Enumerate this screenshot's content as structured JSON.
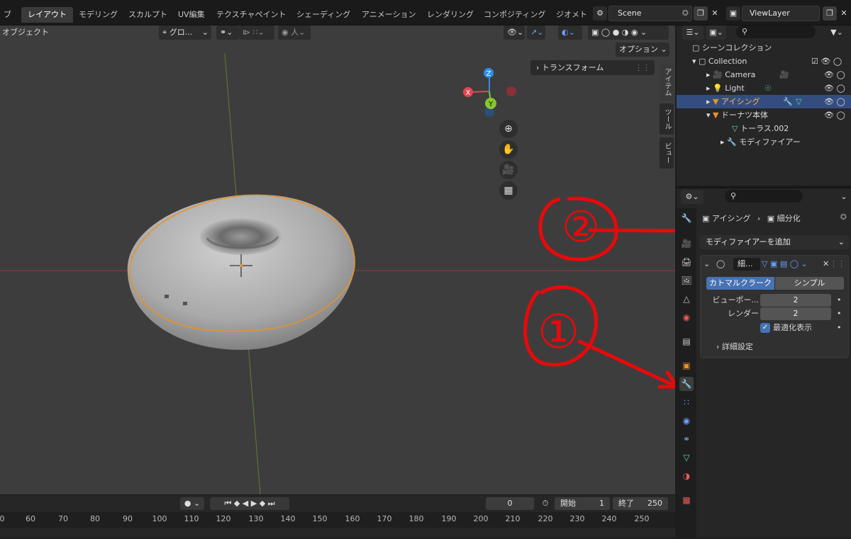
{
  "topbar": {
    "workspaces": [
      "ブ",
      "レイアウト",
      "モデリング",
      "スカルプト",
      "UV編集",
      "テクスチャペイント",
      "シェーディング",
      "アニメーション",
      "レンダリング",
      "コンポジティング",
      "ジオメト"
    ],
    "active_workspace": "レイアウト",
    "scene": "Scene",
    "view_layer": "ViewLayer"
  },
  "viewport": {
    "mode": "オブジェクト",
    "orientation": "グロ...",
    "options_label": "オプション",
    "transform_panel": "トランスフォーム",
    "side_tabs": [
      "アイテム",
      "ツール",
      "ビュー"
    ],
    "gizmo": {
      "z": "Z",
      "y": "Y",
      "x": "X"
    }
  },
  "timeline": {
    "current_frame": "0",
    "start_label": "開始",
    "start": "1",
    "end_label": "終了",
    "end": "250",
    "ruler_ticks": [
      "0",
      "60",
      "70",
      "80",
      "90",
      "100",
      "110",
      "120",
      "130",
      "140",
      "150",
      "160",
      "170",
      "180",
      "190",
      "200",
      "210",
      "220",
      "230",
      "240",
      "250"
    ]
  },
  "outliner": {
    "root": "シーンコレクション",
    "items": [
      {
        "label": "Collection",
        "indent": 0
      },
      {
        "label": "Camera",
        "indent": 1
      },
      {
        "label": "Light",
        "indent": 1
      },
      {
        "label": "アイシング",
        "indent": 1,
        "selected": true
      },
      {
        "label": "ドーナツ本体",
        "indent": 1
      },
      {
        "label": "トーラス.002",
        "indent": 2
      },
      {
        "label": "モディファイアー",
        "indent": 2
      }
    ]
  },
  "properties": {
    "breadcrumb_object": "アイシング",
    "breadcrumb_modifier": "細分化",
    "add_modifier": "モディファイアーを追加",
    "modifier": {
      "name": "細...",
      "algo_catmull": "カトマルクラーク",
      "algo_simple": "シンプル",
      "viewport_label": "ビューポー...",
      "viewport_value": "2",
      "render_label": "レンダー",
      "render_value": "2",
      "optimal_label": "最適化表示",
      "advanced_label": "詳細設定"
    }
  },
  "annotations": {
    "one": "①",
    "two": "②"
  },
  "colors": {
    "accent": "#4772b3",
    "selected_outline": "#e8922a",
    "annotation": "#e8090b",
    "axis_x": "#e34552",
    "axis_y": "#88c530",
    "axis_z": "#2e8ee6"
  }
}
